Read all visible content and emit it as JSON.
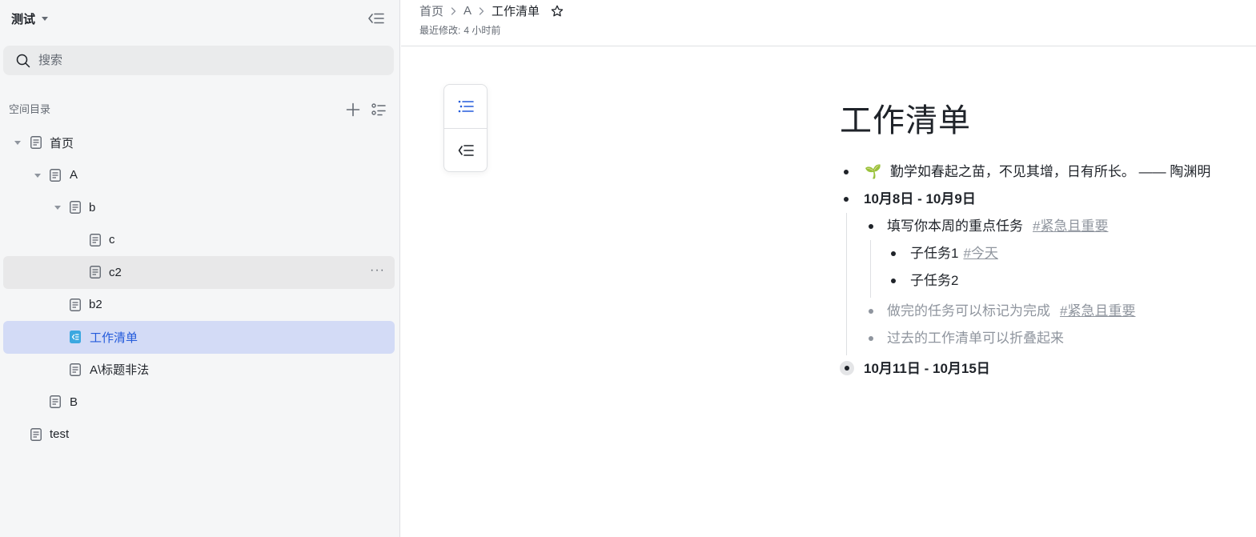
{
  "sidebar": {
    "space_title": "测试",
    "search_placeholder": "搜索",
    "toc_label": "空间目录",
    "tree": [
      {
        "label": "首页"
      },
      {
        "label": "A"
      },
      {
        "label": "b"
      },
      {
        "label": "c"
      },
      {
        "label": "c2",
        "more": "···"
      },
      {
        "label": "b2"
      },
      {
        "label": "工作清单"
      },
      {
        "label": "A\\标题非法"
      },
      {
        "label": "B"
      },
      {
        "label": "test"
      }
    ]
  },
  "topbar": {
    "breadcrumb": [
      "首页",
      "A",
      "工作清单"
    ],
    "modified_label": "最近修改:",
    "modified_value": "4 小时前"
  },
  "document": {
    "title": "工作清单",
    "quote_emoji": "🌱",
    "quote": "勤学如春起之苗，不见其增，日有所长。 —— 陶渊明",
    "section1": "10月8日 - 10月9日",
    "task1": "填写你本周的重点任务",
    "task1_tag": "#紧急且重要",
    "subtask1": "子任务1",
    "subtask1_tag": "#今天",
    "subtask2": "子任务2",
    "task2_done": "做完的任务可以标记为完成",
    "task2_tag": "#紧急且重要",
    "task3": "过去的工作清单可以折叠起来",
    "section2": "10月11日 - 10月15日"
  },
  "colors": {
    "accent": "#245bdb",
    "active_row_bg": "#d3dbf6",
    "sidebar_bg": "#f5f6f7",
    "muted_text": "#8f959e",
    "checklist_icon": "#3ba8e0"
  },
  "icons": {
    "collapse_sidebar": "collapse-sidebar-icon",
    "search": "search-icon",
    "add": "plus-icon",
    "view": "list-view-icon",
    "document": "document-icon",
    "checklist": "checklist-icon",
    "star": "star-icon",
    "outline": "outline-list-icon",
    "collapse_list": "collapse-list-icon"
  }
}
